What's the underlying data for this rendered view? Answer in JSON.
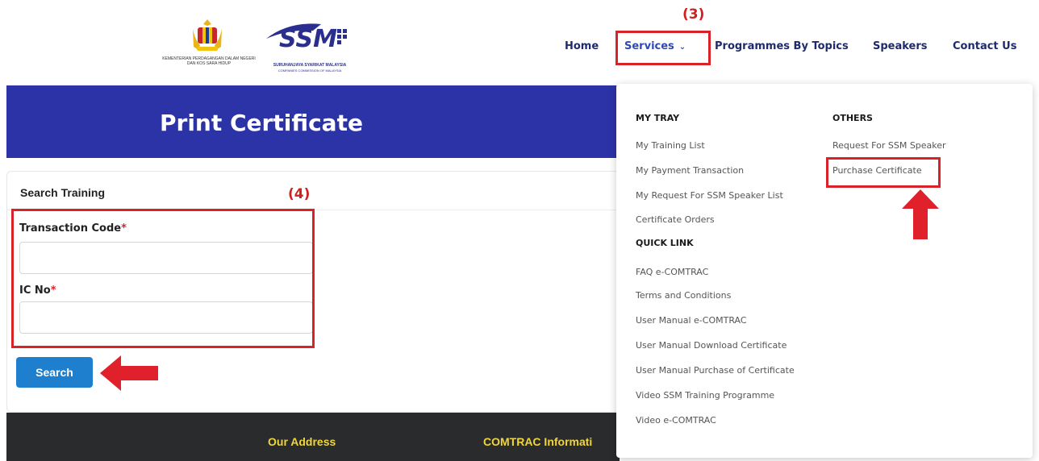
{
  "header": {
    "kpdn_logo_caption": "KEMENTERIAN PERDAGANGAN DALAM NEGERI DAN KOS SARA HIDUP",
    "ssm_logo_caption": "SURUHANJAYA SYARIKAT MALAYSIA",
    "ssm_logo_subcaption": "COMPANIES COMMISSION OF MALAYSIA",
    "nav": {
      "home": "Home",
      "services": "Services",
      "programmes": "Programmes By Topics",
      "speakers": "Speakers",
      "contact": "Contact Us"
    }
  },
  "annotations": {
    "step3": "(3)",
    "step4": "(4)"
  },
  "banner": {
    "title": "Print Certificate"
  },
  "form": {
    "section_title": "Search Training",
    "transaction_code_label": "Transaction Code",
    "ic_no_label": "IC No",
    "required_mark": "*",
    "transaction_code_value": "",
    "ic_no_value": "",
    "search_button": "Search"
  },
  "footer": {
    "address": "Our Address",
    "info": "COMTRAC Informati"
  },
  "dropdown": {
    "my_tray": {
      "heading": "MY TRAY",
      "items": [
        "My Training List",
        "My Payment Transaction",
        "My Request For SSM Speaker List",
        "Certificate Orders"
      ]
    },
    "quick_link": {
      "heading": "QUICK LINK",
      "items": [
        "FAQ e-COMTRAC",
        "Terms and Conditions",
        "User Manual e-COMTRAC",
        "User Manual Download Certificate",
        "User Manual Purchase of Certificate",
        "Video SSM Training Programme",
        "Video e-COMTRAC"
      ]
    },
    "others": {
      "heading": "OTHERS",
      "items": [
        "Request For SSM Speaker",
        "Purchase Certificate"
      ]
    }
  },
  "colors": {
    "banner": "#2c33a6",
    "nav_text": "#1f2a6b",
    "annotation_red": "#d8232a",
    "button_blue": "#1f7fcf",
    "footer_bg": "#2a2b2d",
    "footer_text": "#f0d63a"
  },
  "icons": {
    "services_chevron": "chevron-down-icon",
    "left_arrow": "red-arrow-left-icon",
    "up_arrow": "red-arrow-up-icon"
  }
}
